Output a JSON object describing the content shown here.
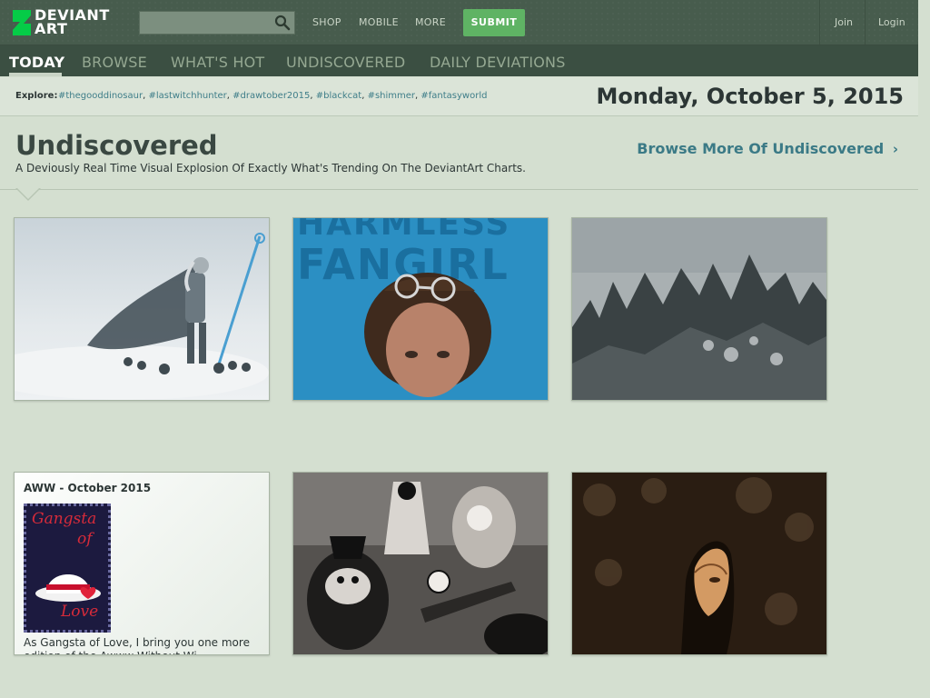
{
  "header": {
    "logo_line1": "DEVIANT",
    "logo_line2": "ART",
    "search_placeholder": "",
    "nav": [
      "SHOP",
      "MOBILE",
      "MORE"
    ],
    "submit_label": "SUBMIT",
    "join_label": "Join",
    "login_label": "Login",
    "colors": {
      "bar": "#475c4d",
      "submit": "#5fb364"
    }
  },
  "tabs": [
    "TODAY",
    "BROWSE",
    "WHAT'S HOT",
    "UNDISCOVERED",
    "DAILY DEVIATIONS"
  ],
  "explore": {
    "label": "Explore:",
    "tags": [
      "#thegooddinosaur",
      "#lastwitchhunter",
      "#drawtober2015",
      "#blackcat",
      "#shimmer",
      "#fantasyworld"
    ]
  },
  "date": "Monday, October 5, 2015",
  "section": {
    "title": "Undiscovered",
    "subtitle": "A Deviously Real Time Visual Explosion Of Exactly What's Trending On The DeviantArt Charts.",
    "browse_more": "Browse More Of Undiscovered"
  },
  "thumbnail_texts": {
    "fangirl_line1": "HARMLESS",
    "fangirl_line2": "FANGIRL"
  },
  "journal": {
    "title": "AWW - October 2015",
    "stamp_words": [
      "Gangsta",
      "of",
      "Love"
    ],
    "excerpt": "As Gangsta of Love, I bring you one more edition of the Awww Without Wi..."
  }
}
